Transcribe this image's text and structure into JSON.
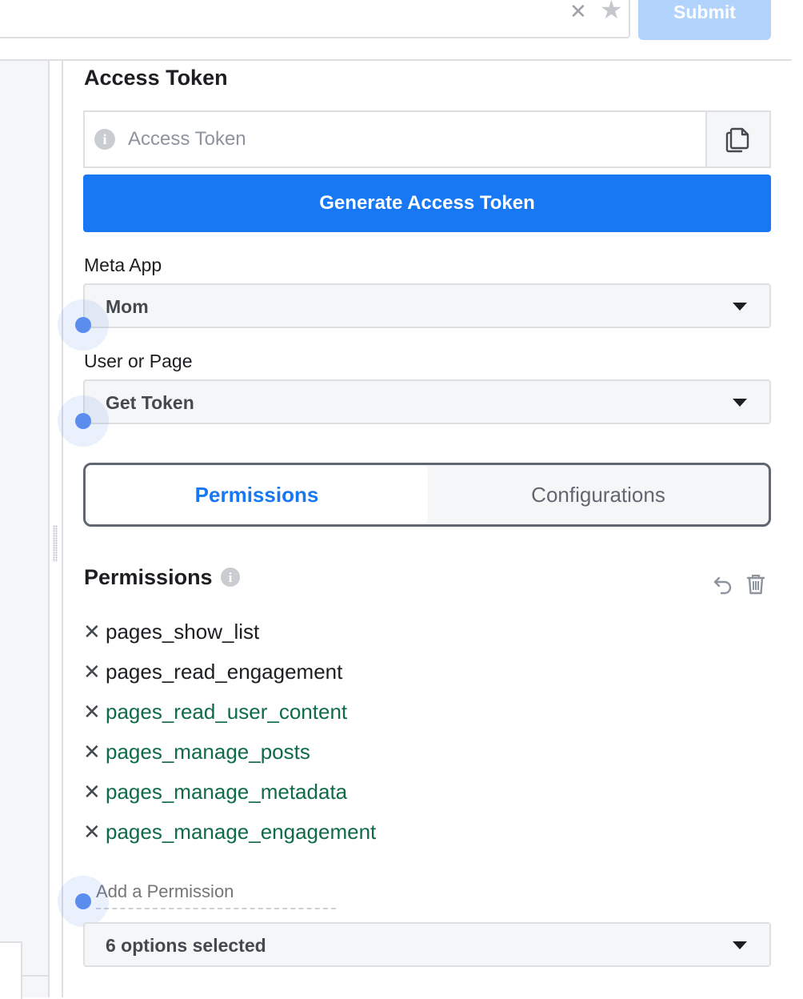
{
  "toolbar": {
    "clear_icon": "close-icon",
    "star_icon": "star-icon",
    "submit_label": "Submit"
  },
  "access_token": {
    "title": "Access Token",
    "placeholder": "Access Token",
    "copy_icon": "copy-icon",
    "generate_label": "Generate Access Token"
  },
  "meta_app": {
    "label": "Meta App",
    "value": "Mom"
  },
  "user_or_page": {
    "label": "User or Page",
    "value": "Get Token"
  },
  "tabs": [
    {
      "label": "Permissions",
      "active": true
    },
    {
      "label": "Configurations",
      "active": false
    }
  ],
  "permissions": {
    "title": "Permissions",
    "info_icon": "info-icon",
    "undo_icon": "undo-icon",
    "trash_icon": "trash-icon",
    "items": [
      {
        "name": "pages_show_list",
        "status": "granted"
      },
      {
        "name": "pages_read_engagement",
        "status": "granted"
      },
      {
        "name": "pages_read_user_content",
        "status": "pending"
      },
      {
        "name": "pages_manage_posts",
        "status": "pending"
      },
      {
        "name": "pages_manage_metadata",
        "status": "pending"
      },
      {
        "name": "pages_manage_engagement",
        "status": "pending"
      }
    ],
    "add_placeholder": "Add a Permission",
    "selected_summary": "6 options selected"
  },
  "colors": {
    "accent": "#1877f2",
    "pending_permission": "#0f6b47",
    "tour_dot": "#5b8def"
  }
}
